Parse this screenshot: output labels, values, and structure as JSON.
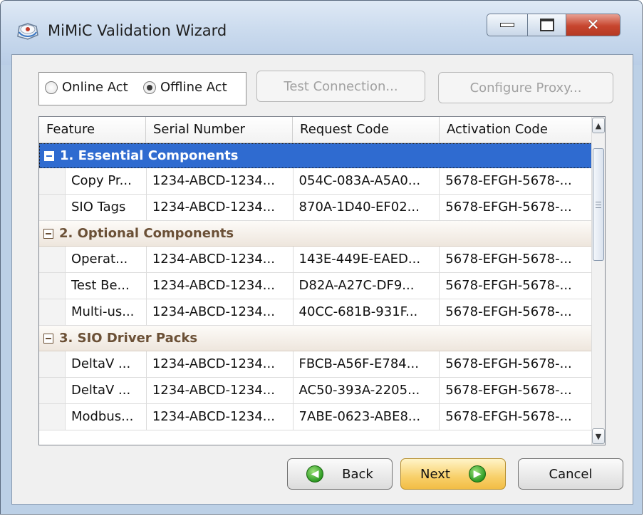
{
  "window": {
    "title": "MiMiC Validation Wizard"
  },
  "toolbar": {
    "online_label": "Online Act",
    "offline_label": "Offline Act",
    "test_connection_label": "Test Connection...",
    "configure_proxy_label": "Configure Proxy..."
  },
  "grid": {
    "columns": [
      "Feature",
      "Serial Number",
      "Request Code",
      "Activation Code"
    ],
    "groups": [
      {
        "label": "1. Essential Components",
        "selected": true,
        "rows": [
          [
            "Copy Pr...",
            "1234-ABCD-1234...",
            "054C-083A-A5A0...",
            "5678-EFGH-5678-..."
          ],
          [
            "SIO Tags",
            "1234-ABCD-1234...",
            "870A-1D40-EF02...",
            "5678-EFGH-5678-..."
          ]
        ]
      },
      {
        "label": "2. Optional Components",
        "selected": false,
        "rows": [
          [
            "Operat...",
            "1234-ABCD-1234...",
            "143E-449E-EAED...",
            "5678-EFGH-5678-..."
          ],
          [
            "Test Be...",
            "1234-ABCD-1234...",
            "D82A-A27C-DF9...",
            "5678-EFGH-5678-..."
          ],
          [
            "Multi-us...",
            "1234-ABCD-1234...",
            "40CC-681B-931F...",
            "5678-EFGH-5678-..."
          ]
        ]
      },
      {
        "label": "3. SIO Driver Packs",
        "selected": false,
        "rows": [
          [
            "DeltaV ...",
            "1234-ABCD-1234...",
            "FBCB-A56F-E784...",
            "5678-EFGH-5678-..."
          ],
          [
            "DeltaV ...",
            "1234-ABCD-1234...",
            "AC50-393A-2205...",
            "5678-EFGH-5678-..."
          ],
          [
            "Modbus...",
            "1234-ABCD-1234...",
            "7ABE-0623-ABE8...",
            "5678-EFGH-5678-..."
          ]
        ]
      }
    ]
  },
  "footer": {
    "back_label": "Back",
    "next_label": "Next",
    "cancel_label": "Cancel"
  }
}
